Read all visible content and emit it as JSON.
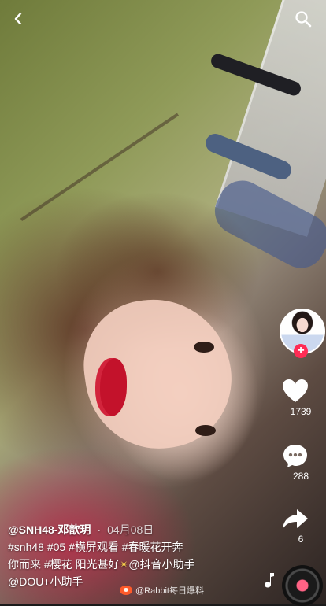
{
  "topbar": {
    "back_icon": "back-icon",
    "search_icon": "search-icon"
  },
  "rail": {
    "avatar_name": "creator-avatar",
    "follow_label": "+",
    "like_count": "1739",
    "comment_count": "288",
    "share_count": "6"
  },
  "caption": {
    "author": "@SNH48-邓歆玥",
    "separator": "·",
    "date": "04月08日",
    "line1": "#snh48 #05 #横屏观看 #春暖花开奔",
    "line2_prefix": "你而来 #樱花 阳光甚好",
    "line2_emoji": "✴",
    "line2_suffix": "@抖音小助手",
    "line3": "@DOU+小助手"
  },
  "watermark": {
    "text": "@Rabbit每日爆料"
  },
  "colors": {
    "accent": "#ff2c55",
    "icon": "#ffffff"
  }
}
